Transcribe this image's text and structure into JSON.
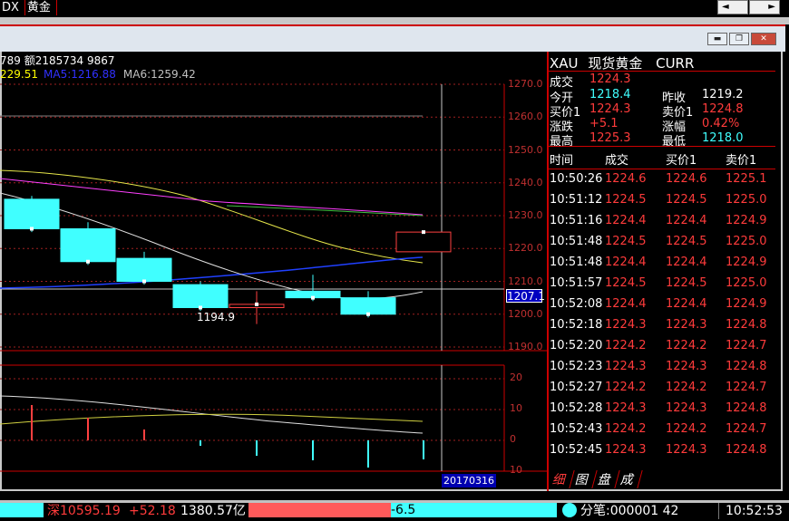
{
  "tabs": [
    "DX",
    "黄金"
  ],
  "window": {
    "controls": [
      "minimize",
      "restore",
      "close"
    ]
  },
  "chart_header": {
    "ohlc_text": "789 额2185734 9867",
    "ma_prev": "229.51",
    "ma5": "MA5:1216.88",
    "ma6": "MA6:1259.42"
  },
  "chart_data": {
    "type": "candlestick",
    "price_axis": [
      "1270.0",
      "1260.0",
      "1250.0",
      "1240.0",
      "1230.0",
      "1220.0",
      "1210.0",
      "1200.0",
      "1190.0"
    ],
    "ylim": [
      1190,
      1270
    ],
    "current_price_label": "1207.1",
    "low_annotation": "1194.9",
    "candles": [
      {
        "o": 1235,
        "c": 1226,
        "h": 1236,
        "l": 1225
      },
      {
        "o": 1226,
        "c": 1216,
        "h": 1228,
        "l": 1215
      },
      {
        "o": 1217,
        "c": 1210,
        "h": 1219,
        "l": 1209
      },
      {
        "o": 1209,
        "c": 1202,
        "h": 1210,
        "l": 1201
      },
      {
        "o": 1202,
        "c": 1203,
        "h": 1207,
        "l": 1197
      },
      {
        "o": 1207,
        "c": 1205,
        "h": 1212,
        "l": 1204
      },
      {
        "o": 1205,
        "c": 1200,
        "h": 1207,
        "l": 1199
      },
      {
        "o": 1219,
        "c": 1225,
        "h": 1225,
        "l": 1219
      }
    ],
    "sub_axis": [
      "20",
      "10",
      "0",
      "10"
    ],
    "date_label": "20170316"
  },
  "quote": {
    "symbol": "XAU",
    "name": "现货黄金",
    "market": "CURR",
    "last_label": "成交",
    "last": "1224.3",
    "open_label": "今开",
    "open": "1218.4",
    "prev_close_label": "昨收",
    "prev_close": "1219.2",
    "bid_label": "买价1",
    "bid": "1224.3",
    "ask_label": "卖价1",
    "ask": "1224.8",
    "change_label": "涨跌",
    "change": "+5.1",
    "pct_label": "涨幅",
    "pct": "0.42%",
    "high_label": "最高",
    "high": "1225.3",
    "low_label": "最低",
    "low": "1218.0"
  },
  "ticks": {
    "headers": [
      "时间",
      "成交",
      "买价1",
      "卖价1"
    ],
    "rows": [
      [
        "10:50:26",
        "1224.6",
        "1224.6",
        "1225.1"
      ],
      [
        "10:51:12",
        "1224.5",
        "1224.5",
        "1225.0"
      ],
      [
        "10:51:16",
        "1224.4",
        "1224.4",
        "1224.9"
      ],
      [
        "10:51:48",
        "1224.5",
        "1224.5",
        "1225.0"
      ],
      [
        "10:51:48",
        "1224.4",
        "1224.4",
        "1224.9"
      ],
      [
        "10:51:57",
        "1224.5",
        "1224.5",
        "1225.0"
      ],
      [
        "10:52:08",
        "1224.4",
        "1224.4",
        "1224.9"
      ],
      [
        "10:52:18",
        "1224.3",
        "1224.3",
        "1224.8"
      ],
      [
        "10:52:20",
        "1224.2",
        "1224.2",
        "1224.7"
      ],
      [
        "10:52:23",
        "1224.3",
        "1224.3",
        "1224.8"
      ],
      [
        "10:52:27",
        "1224.2",
        "1224.2",
        "1224.7"
      ],
      [
        "10:52:28",
        "1224.3",
        "1224.3",
        "1224.8"
      ],
      [
        "10:52:43",
        "1224.2",
        "1224.2",
        "1224.7"
      ],
      [
        "10:52:45",
        "1224.3",
        "1224.3",
        "1224.8"
      ]
    ]
  },
  "bottom_tabs": [
    "细",
    "图",
    "盘",
    "成"
  ],
  "status": {
    "index": "深10595.19",
    "index_change": "+52.18",
    "amount": "1380.57亿",
    "bar_value": "-6.5",
    "ticker": "分笔:000001 42",
    "time": "10:52:53"
  }
}
